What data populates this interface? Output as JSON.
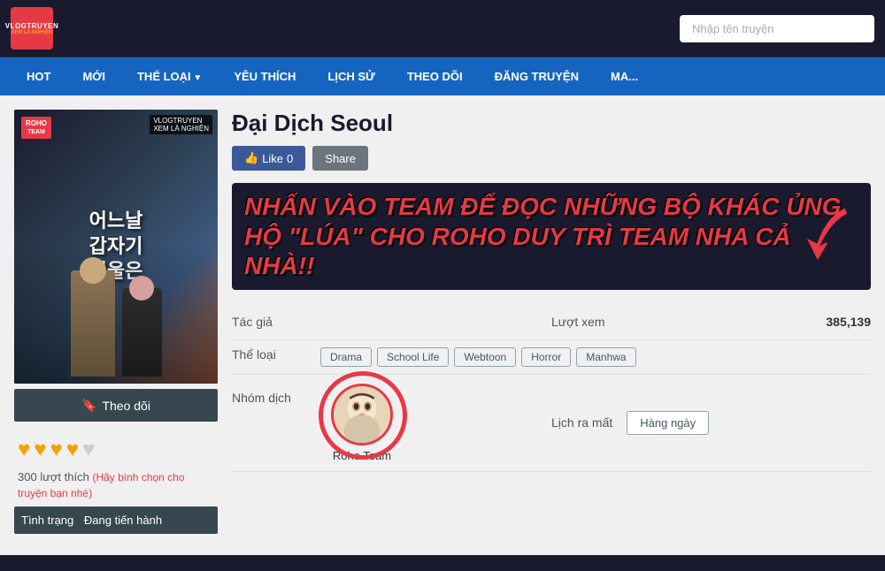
{
  "header": {
    "logo_top": "VLOGTRUYEN",
    "logo_bottom": "XEM LÀ NGHIỆN",
    "search_placeholder": "Nhập tên truyện"
  },
  "nav": {
    "items": [
      {
        "label": "HOT",
        "has_arrow": false
      },
      {
        "label": "MỚI",
        "has_arrow": false
      },
      {
        "label": "THỂ LOẠI",
        "has_arrow": true
      },
      {
        "label": "YÊU THÍCH",
        "has_arrow": false
      },
      {
        "label": "LỊCH SỬ",
        "has_arrow": false
      },
      {
        "label": "THEO DÕI",
        "has_arrow": false
      },
      {
        "label": "ĐĂNG TRUYỆN",
        "has_arrow": false
      },
      {
        "label": "MA...",
        "has_arrow": false
      }
    ]
  },
  "manga": {
    "title": "Đại Dịch Seoul",
    "cover_title": "어느날\n갑자기\n서울은",
    "roho_badge_line1": "ROHO",
    "roho_badge_line2": "TEAM",
    "vlog_label": "VLOGTRUYEN\nXEM LÀ NGHIỆN",
    "like_count": "0",
    "like_label": "Like",
    "share_label": "Share",
    "promo_text": "NHẤN VÀO TEAM ĐỂ ĐỌC NHỮNG BỘ KHÁC ỦNG HỘ \"LÚA\" CHO ROHO DUY TRÌ TEAM NHA CẢ NHÀ!!",
    "tac_gia_label": "Tác giả",
    "tac_gia_value": "",
    "luot_xem_label": "Lượt xem",
    "luot_xem_value": "385,139",
    "the_loai_label": "Thể loại",
    "genres": [
      "Drama",
      "School Life",
      "Webtoon",
      "Horror",
      "Manhwa"
    ],
    "nhom_dich_label": "Nhóm dịch",
    "translator_name": "Roho Team",
    "lich_ra_mat_label": "Lịch ra mất",
    "lich_ra_mat_value": "Hàng ngày",
    "theo_doi_btn": "Theo dõi",
    "stars_count": 4,
    "votes_count": "300",
    "votes_label": "lượt thích",
    "votes_prompt": "(Hãy bình chọn cho truyện bạn nhé)",
    "tinh_trang_label": "Tình trạng",
    "tinh_trang_value": "Đang tiến hành"
  }
}
